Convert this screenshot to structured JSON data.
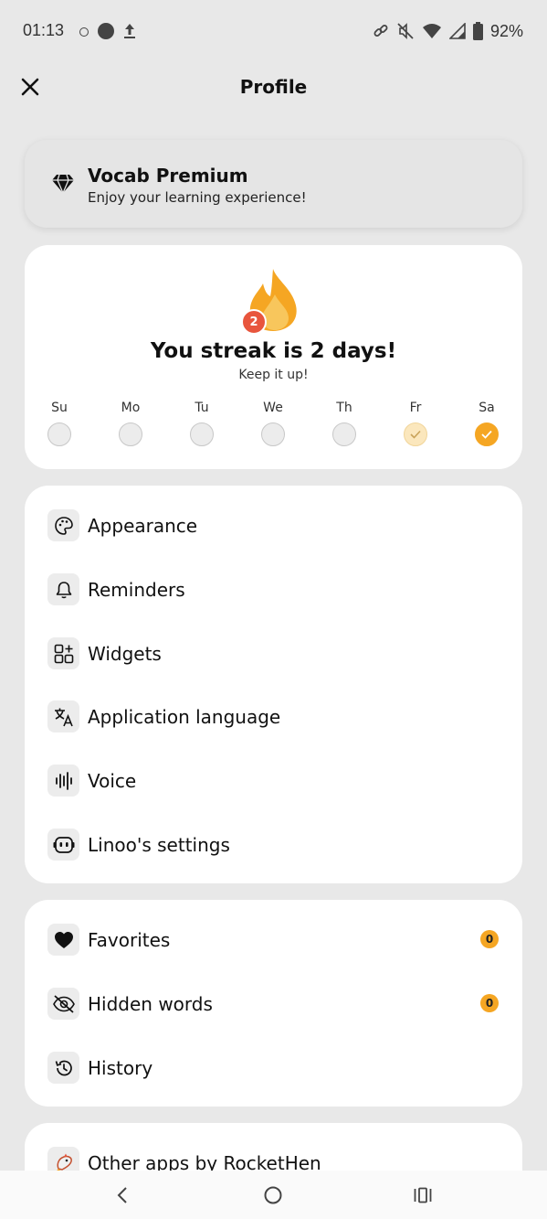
{
  "status_bar": {
    "time": "01:13",
    "battery": "92%"
  },
  "header": {
    "title": "Profile",
    "close_icon": "close-icon"
  },
  "premium": {
    "title": "Vocab Premium",
    "subtitle": "Enjoy your learning experience!",
    "icon": "diamond-icon"
  },
  "streak": {
    "count": "2",
    "title": "You streak is 2 days!",
    "subtitle": "Keep it up!",
    "days": [
      {
        "label": "Su",
        "state": "empty"
      },
      {
        "label": "Mo",
        "state": "empty"
      },
      {
        "label": "Tu",
        "state": "empty"
      },
      {
        "label": "We",
        "state": "empty"
      },
      {
        "label": "Th",
        "state": "empty"
      },
      {
        "label": "Fr",
        "state": "partial"
      },
      {
        "label": "Sa",
        "state": "done"
      }
    ],
    "accent_color": "#f5a623",
    "badge_color": "#e8553d"
  },
  "settings": {
    "items": [
      {
        "label": "Appearance",
        "icon": "palette-icon"
      },
      {
        "label": "Reminders",
        "icon": "bell-icon"
      },
      {
        "label": "Widgets",
        "icon": "widgets-icon"
      },
      {
        "label": "Application language",
        "icon": "translate-icon"
      },
      {
        "label": "Voice",
        "icon": "voice-icon"
      },
      {
        "label": "Linoo's settings",
        "icon": "robot-icon"
      }
    ]
  },
  "lists": {
    "items": [
      {
        "label": "Favorites",
        "icon": "heart-icon",
        "count": "0"
      },
      {
        "label": "Hidden words",
        "icon": "eye-off-icon",
        "count": "0"
      },
      {
        "label": "History",
        "icon": "history-icon"
      }
    ]
  },
  "other": {
    "label": "Other apps by RocketHen",
    "icon": "rockethen-icon"
  }
}
